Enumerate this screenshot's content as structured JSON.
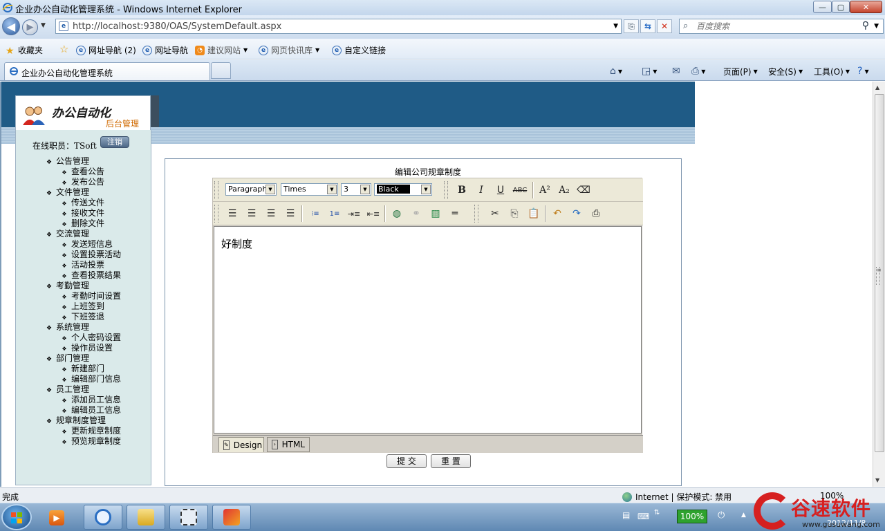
{
  "window": {
    "title": "企业办公自动化管理系统 - Windows Internet Explorer",
    "min_label": "—",
    "max_label": "▢",
    "close_label": "✕"
  },
  "address_bar": {
    "url": "http://localhost:9380/OAS/SystemDefault.aspx",
    "search_placeholder": "百度搜索"
  },
  "favorites_bar": {
    "favorites_label": "收藏夹",
    "items": [
      "网址导航 (2)",
      "网址导航",
      "建议网站",
      "网页快讯库",
      "自定义链接"
    ]
  },
  "tabs": {
    "active_tab": "企业办公自动化管理系统"
  },
  "command_bar": {
    "page": "页面(P)",
    "safety": "安全(S)",
    "tools": "工具(O)"
  },
  "logo": {
    "title": "办公自动化",
    "subtitle": "后台管理"
  },
  "sidebar": {
    "online_label": "在线职员：TSoft",
    "logout": "注销",
    "categories": [
      {
        "label": "公告管理",
        "items": [
          "查看公告",
          "发布公告"
        ]
      },
      {
        "label": "文件管理",
        "items": [
          "传送文件",
          "接收文件",
          "删除文件"
        ]
      },
      {
        "label": "交流管理",
        "items": [
          "发送短信息",
          "设置投票活动",
          "活动投票",
          "查看投票结果"
        ]
      },
      {
        "label": "考勤管理",
        "items": [
          "考勤时间设置",
          "上班签到",
          "下班签退"
        ]
      },
      {
        "label": "系统管理",
        "items": [
          "个人密码设置",
          "操作员设置"
        ]
      },
      {
        "label": "部门管理",
        "items": [
          "新建部门",
          "编辑部门信息"
        ]
      },
      {
        "label": "员工管理",
        "items": [
          "添加员工信息",
          "编辑员工信息"
        ]
      },
      {
        "label": "规章制度管理",
        "items": [
          "更新规章制度",
          "预览规章制度"
        ]
      }
    ]
  },
  "editor": {
    "title": "编辑公司规章制度",
    "format_select": "Paragraph",
    "font_select": "Times",
    "size_select": "3",
    "color_select": "Black",
    "content": "好制度",
    "mode_design": "Design",
    "mode_html": "HTML"
  },
  "form": {
    "submit": "提 交",
    "reset": "重 置"
  },
  "status_bar": {
    "status": "完成",
    "zone": "Internet | 保护模式: 禁用",
    "zoom": "100%"
  },
  "taskbar": {
    "battery": "100%",
    "date": "2012/11/8"
  },
  "watermark": {
    "text": "谷速软件",
    "url": "www.gusuwang.com"
  }
}
